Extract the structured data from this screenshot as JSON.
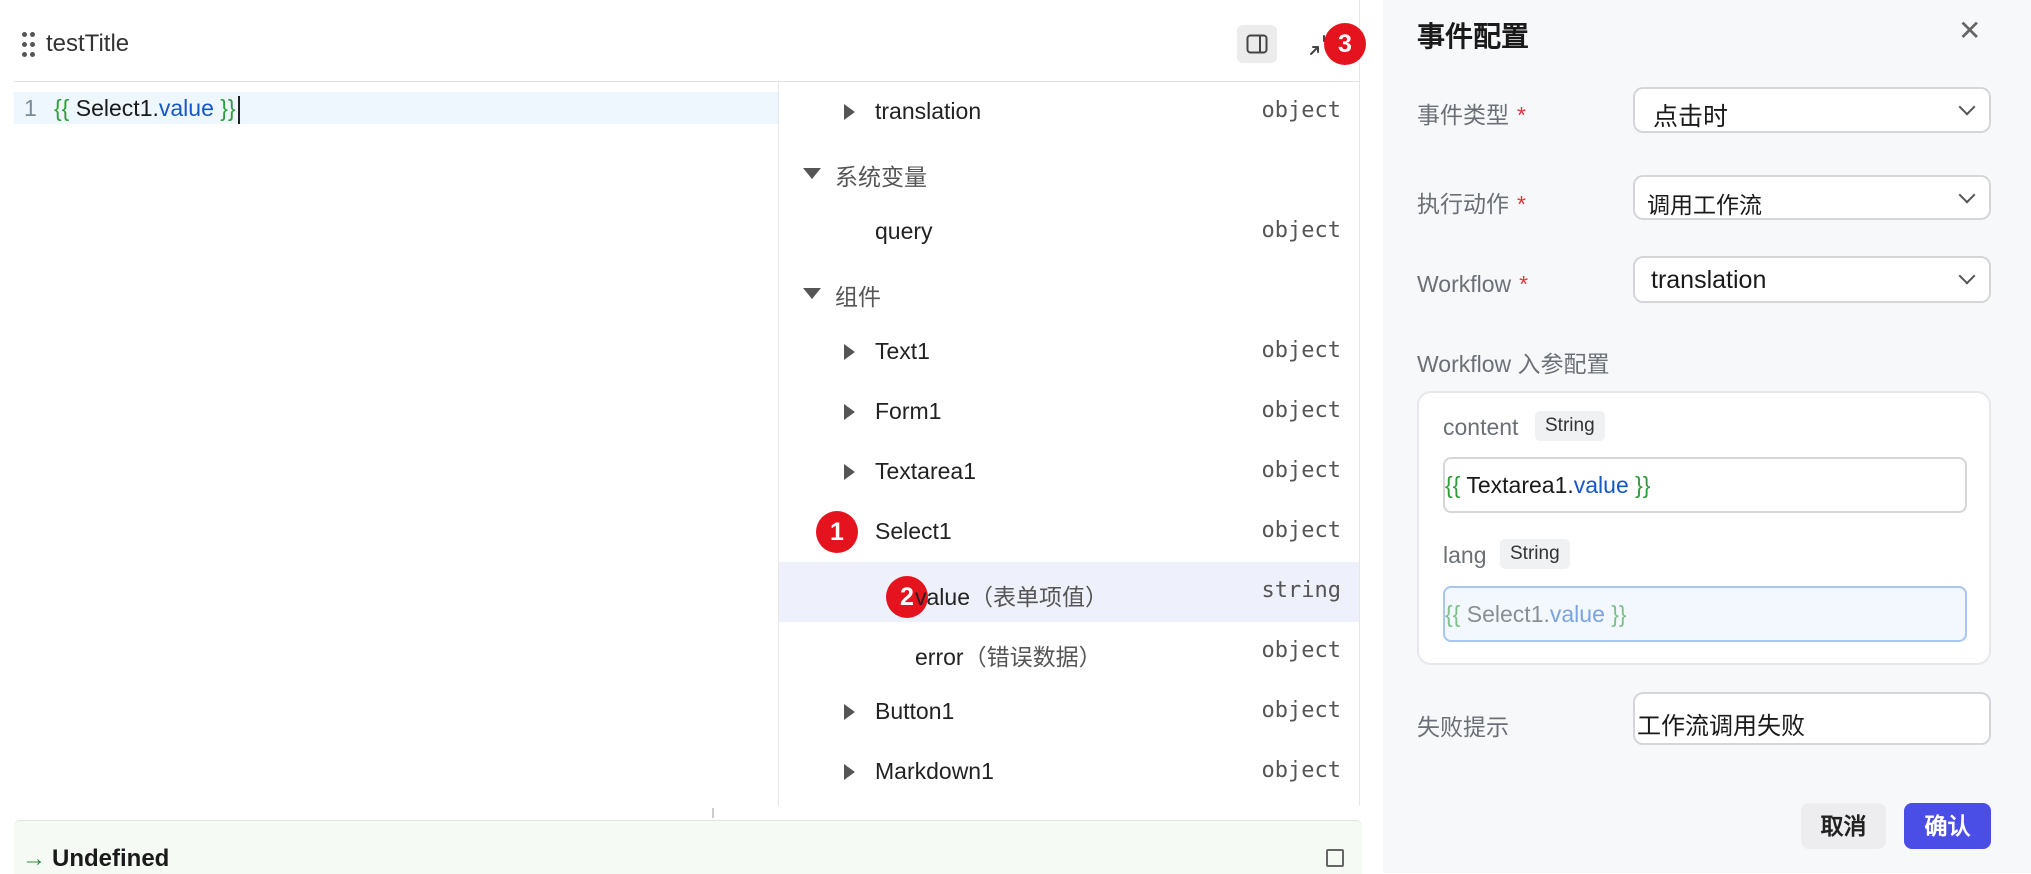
{
  "panel": {
    "title": "testTitle",
    "badge_collapse": "3"
  },
  "editor": {
    "line_number": "1",
    "code_open": "{{",
    "code_name": " Select1.",
    "code_prop": "value",
    "code_close": " }}"
  },
  "tree": {
    "translation": {
      "label": "translation",
      "type": "object"
    },
    "system_group": "系统变量",
    "query": {
      "label": "query",
      "type": "object"
    },
    "components_group": "组件",
    "text1": {
      "label": "Text1",
      "type": "object"
    },
    "form1": {
      "label": "Form1",
      "type": "object"
    },
    "textarea1": {
      "label": "Textarea1",
      "type": "object"
    },
    "select1": {
      "label": "Select1",
      "type": "object",
      "badge": "1"
    },
    "value": {
      "label": "value",
      "note": "（表单项值）",
      "type": "string",
      "badge": "2"
    },
    "error": {
      "label": "error",
      "note": "（错误数据）",
      "type": "object"
    },
    "button1": {
      "label": "Button1",
      "type": "object"
    },
    "markdown1": {
      "label": "Markdown1",
      "type": "object"
    }
  },
  "result": {
    "label": "Undefined"
  },
  "drawer": {
    "title": "事件配置",
    "event_type_label": "事件类型",
    "event_type_value": "点击时",
    "action_label": "执行动作",
    "action_value": "调用工作流",
    "workflow_label": "Workflow",
    "workflow_value": "translation",
    "params_label": "Workflow 入参配置",
    "required_mark": "*",
    "params": {
      "content": {
        "name": "content",
        "type": "String",
        "expr_open": "{{",
        "expr_name": " Textarea1.",
        "expr_prop": "value",
        "expr_close": " }}"
      },
      "lang": {
        "name": "lang",
        "type": "String",
        "expr_open": "{{",
        "expr_name": " Select1.",
        "expr_prop": "value",
        "expr_close": " }}"
      }
    },
    "fail_label": "失败提示",
    "fail_value": "工作流调用失败",
    "cancel_label": "取消",
    "confirm_label": "确认"
  },
  "colors": {
    "badge": "#e5131d",
    "confirm": "#4a4de6",
    "required": "#e5353b",
    "selected_row": "#eef0fb"
  }
}
